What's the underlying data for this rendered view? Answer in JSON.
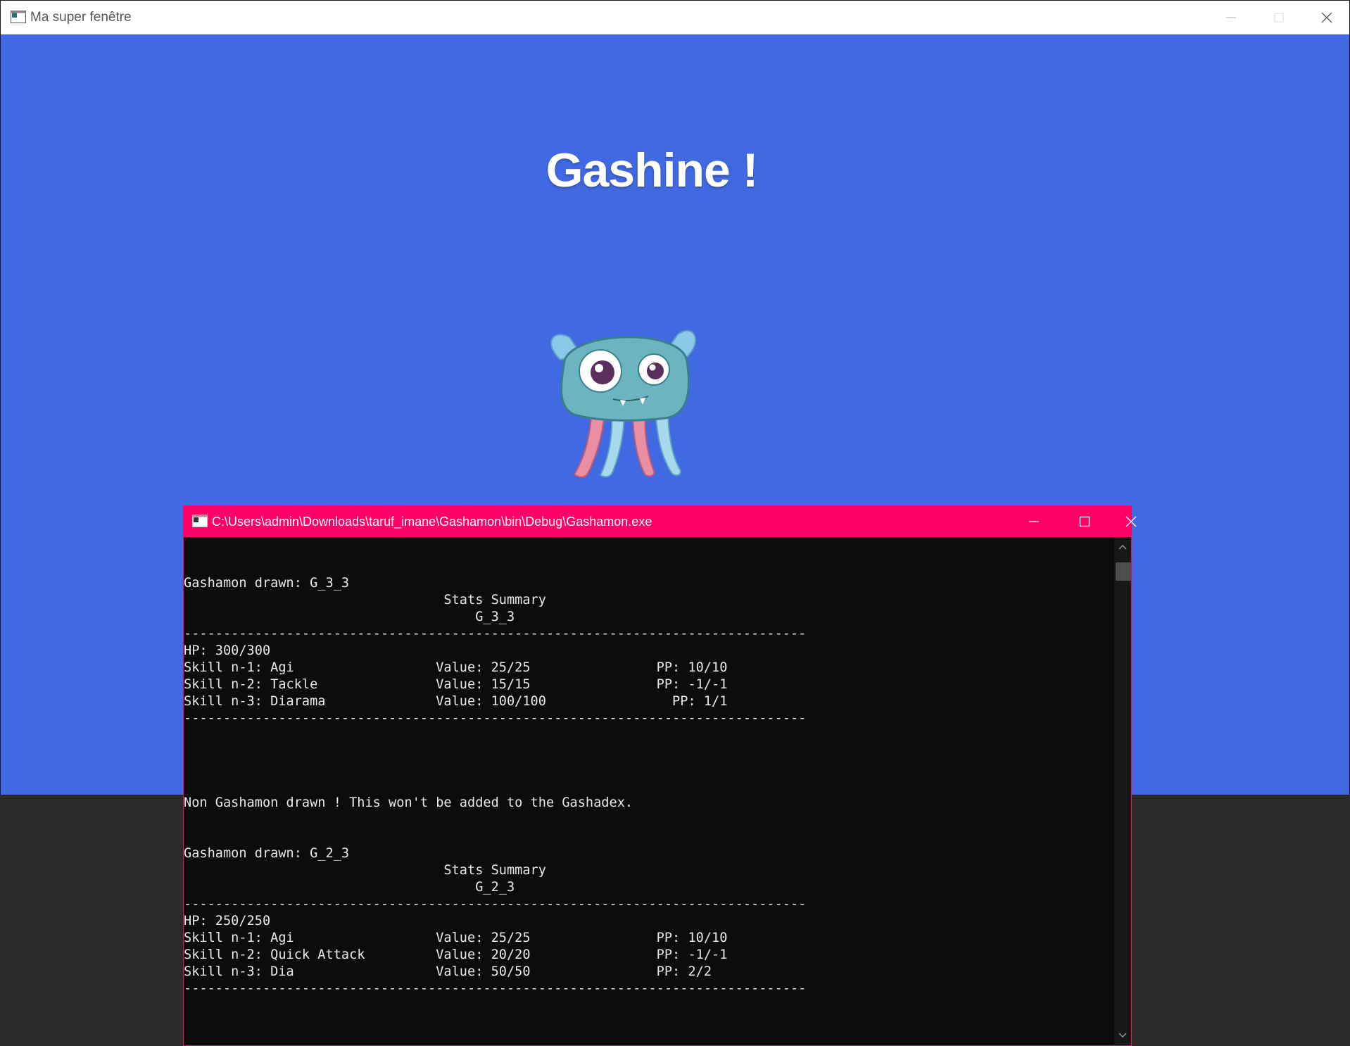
{
  "main_window": {
    "title": "Ma super fenêtre",
    "background_color": "#4169e1",
    "game_title": "Gashine !",
    "image": "teal-monster-creature"
  },
  "console_window": {
    "title": "C:\\Users\\admin\\Downloads\\taruf_imane\\Gashamon\\bin\\Debug\\Gashamon.exe",
    "accent_color": "#ff0066",
    "lines": [
      "",
      "Gashamon drawn: G_3_3",
      "                                 Stats Summary",
      "                                     G_3_3",
      "-------------------------------------------------------------------------------",
      "HP: 300/300",
      "Skill n-1: Agi                  Value: 25/25                PP: 10/10",
      "Skill n-2: Tackle               Value: 15/15                PP: -1/-1",
      "Skill n-3: Diarama              Value: 100/100                PP: 1/1",
      "-------------------------------------------------------------------------------",
      "",
      "",
      "",
      "",
      "Non Gashamon drawn ! This won't be added to the Gashadex.",
      "",
      "",
      "Gashamon drawn: G_2_3",
      "                                 Stats Summary",
      "                                     G_2_3",
      "-------------------------------------------------------------------------------",
      "HP: 250/250",
      "Skill n-1: Agi                  Value: 25/25                PP: 10/10",
      "Skill n-2: Quick Attack         Value: 20/20                PP: -1/-1",
      "Skill n-3: Dia                  Value: 50/50                PP: 2/2",
      "-------------------------------------------------------------------------------"
    ]
  },
  "icons": {
    "minimize": "minimize-icon",
    "maximize": "maximize-icon",
    "close": "close-icon",
    "scroll_up": "chevron-up-icon",
    "scroll_down": "chevron-down-icon"
  }
}
